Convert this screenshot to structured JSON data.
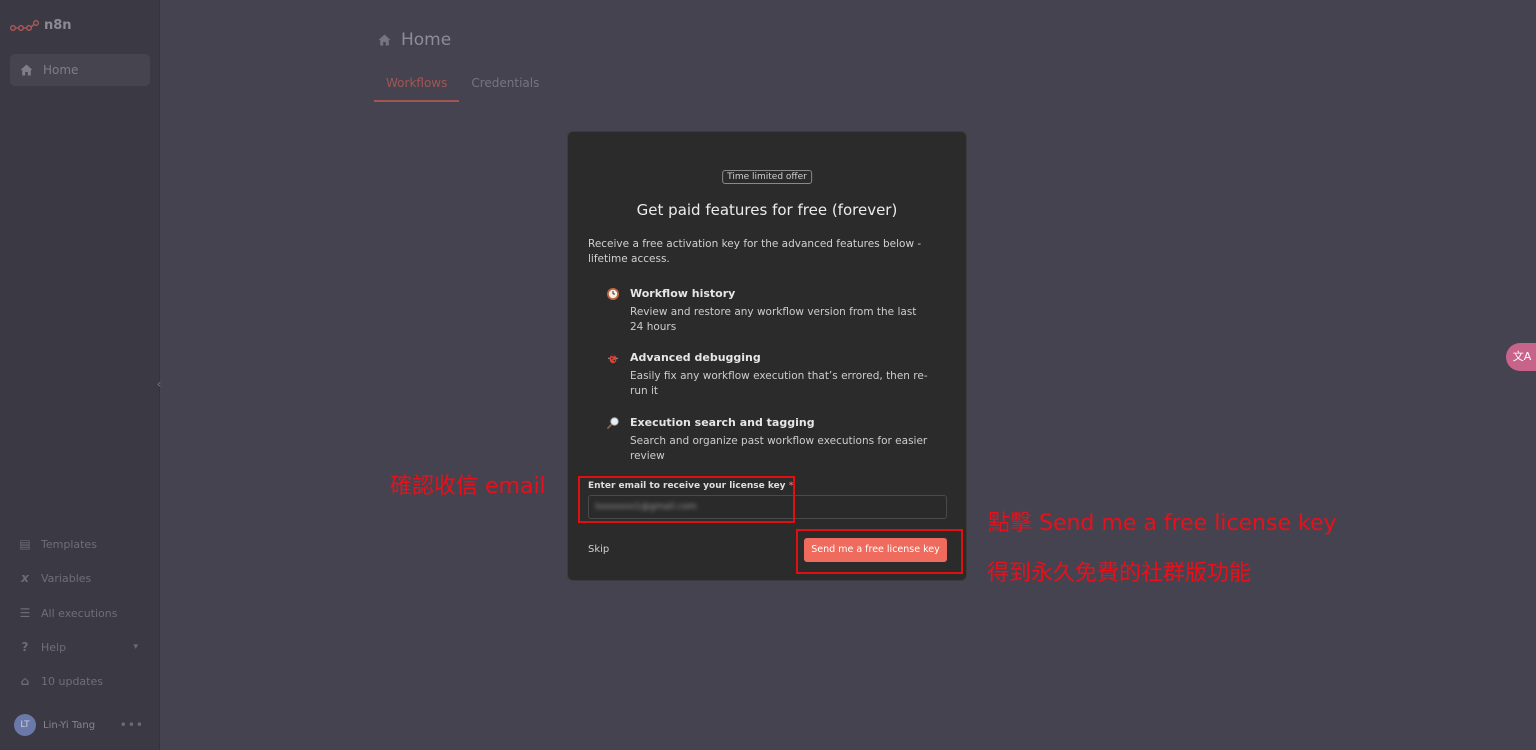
{
  "app": {
    "name": "n8n"
  },
  "sidebar": {
    "home_label": "Home",
    "collapse_glyph": "‹",
    "bottom_items": [
      {
        "label": "Templates",
        "icon": "box-icon"
      },
      {
        "label": "Variables",
        "icon": "variable-icon"
      },
      {
        "label": "All executions",
        "icon": "list-icon"
      },
      {
        "label": "Help",
        "icon": "help-icon"
      },
      {
        "label": "10 updates",
        "icon": "gift-icon"
      }
    ],
    "user": {
      "initials": "LT",
      "name": "Lin-Yi Tang"
    }
  },
  "header": {
    "title": "Home",
    "tabs": [
      {
        "label": "Workflows",
        "active": true
      },
      {
        "label": "Credentials",
        "active": false
      }
    ]
  },
  "modal": {
    "badge": "Time limited offer",
    "title": "Get paid features for free (forever)",
    "description": "Receive a free activation key for the advanced features below - lifetime access.",
    "features": [
      {
        "icon": "clock-icon",
        "title": "Workflow history",
        "desc": "Review and restore any workflow version from the last 24 hours"
      },
      {
        "icon": "bug-icon",
        "title": "Advanced debugging",
        "desc": "Easily fix any workflow execution that’s errored, then re-run it"
      },
      {
        "icon": "magnifier-icon",
        "title": "Execution search and tagging",
        "desc": "Search and organize past workflow executions for easier review"
      }
    ],
    "email_label": "Enter email to receive your license key",
    "email_required_marker": "*",
    "email_value": "lxxxxxxx1@gmail.com",
    "skip_label": "Skip",
    "send_label": "Send me a free license key"
  },
  "annotations": {
    "confirm_email": "確認收信 email",
    "click_send": "點擊 Send me a free license key",
    "get_free": "得到永久免費的社群版功能",
    "color": "#e01010"
  },
  "floating": {
    "translate_glyph": "文A"
  },
  "colors": {
    "accent": "#ee6b5d",
    "tab_active": "#a25653",
    "background": "#45434f"
  }
}
